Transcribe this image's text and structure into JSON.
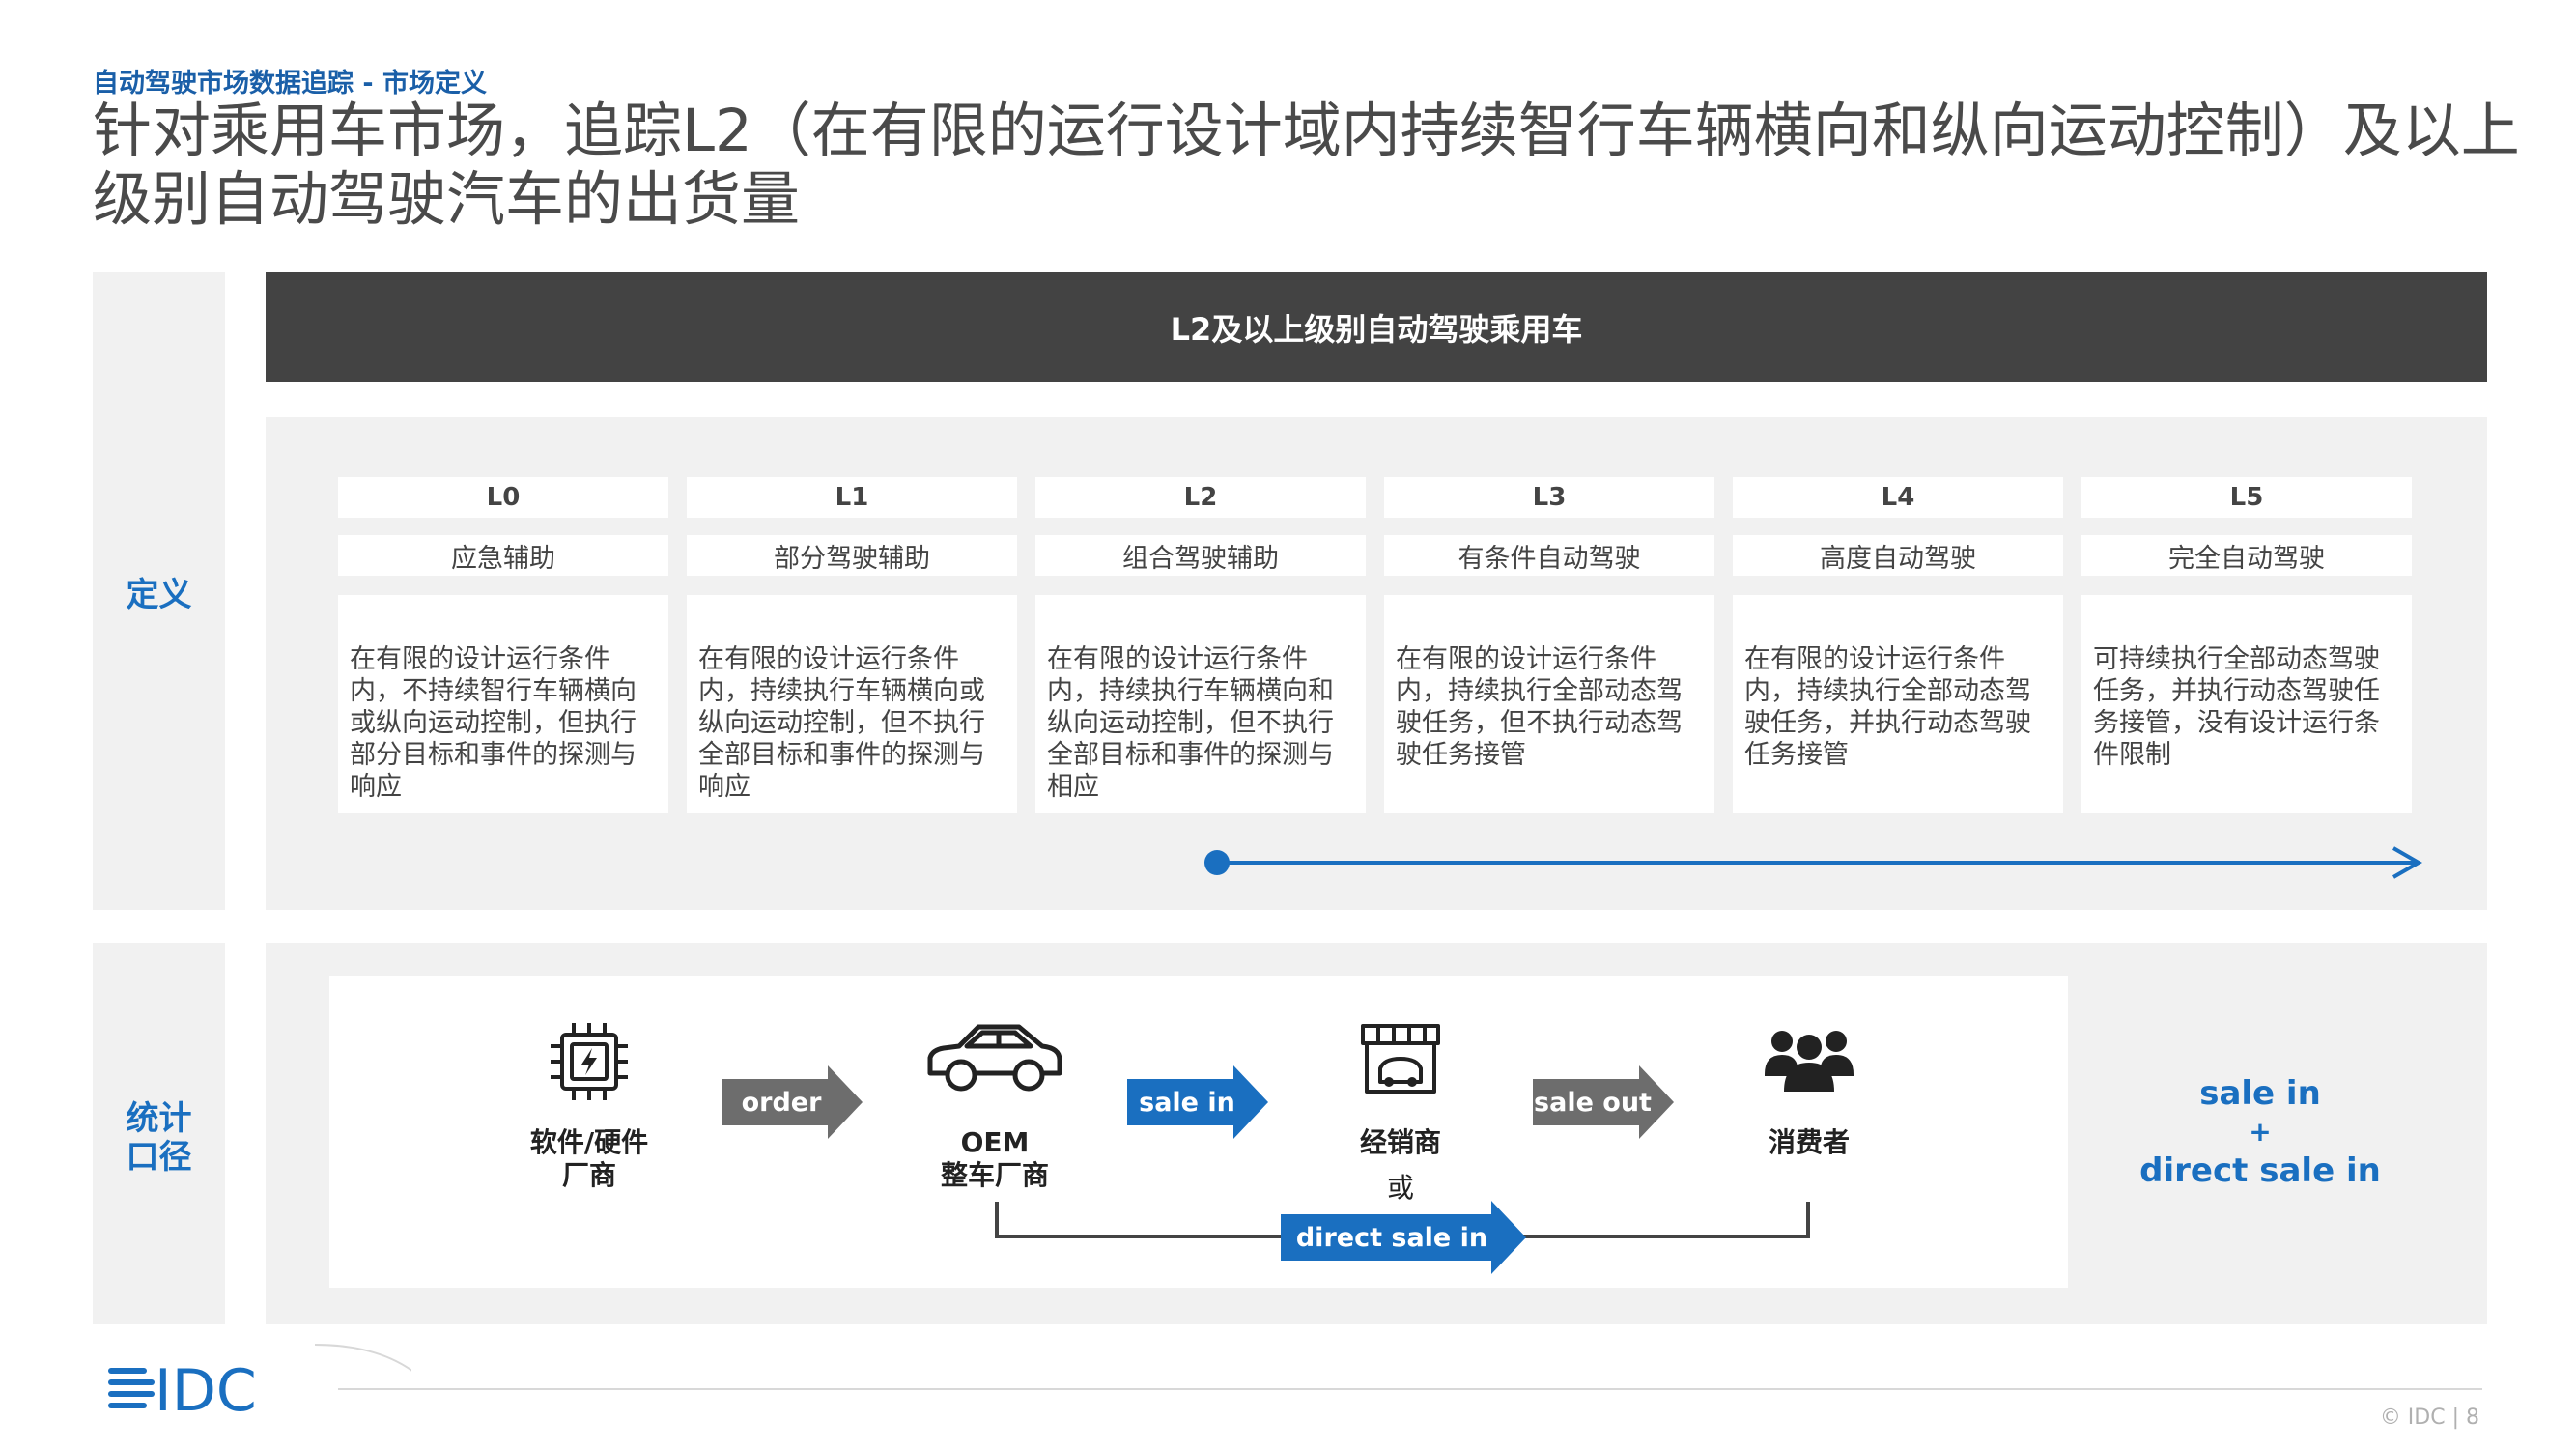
{
  "header": {
    "supertitle": "自动驾驶市场数据追踪 - 市场定义",
    "title": "针对乘用车市场，追踪L2（在有限的运行设计域内持续智行车辆横向和纵向运动控制）及以上级别自动驾驶汽车的出货量"
  },
  "sections": {
    "definition_label": "定义",
    "scope_label_line1": "统计",
    "scope_label_line2": "口径"
  },
  "banner": {
    "text": "L2及以上级别自动驾驶乘用车"
  },
  "levels": [
    {
      "level": "L0",
      "name": "应急辅助",
      "desc": "在有限的设计运行条件内，不持续智行车辆横向或纵向运动控制，但执行部分目标和事件的探测与响应"
    },
    {
      "level": "L1",
      "name": "部分驾驶辅助",
      "desc": "在有限的设计运行条件内，持续执行车辆横向或纵向运动控制，但不执行全部目标和事件的探测与响应"
    },
    {
      "level": "L2",
      "name": "组合驾驶辅助",
      "desc": "在有限的设计运行条件内，持续执行车辆横向和纵向运动控制，但不执行全部目标和事件的探测与相应"
    },
    {
      "level": "L3",
      "name": "有条件自动驾驶",
      "desc": "在有限的设计运行条件内，持续执行全部动态驾驶任务，但不执行动态驾驶任务接管"
    },
    {
      "level": "L4",
      "name": "高度自动驾驶",
      "desc": "在有限的设计运行条件内，持续执行全部动态驾驶任务，并执行动态驾驶任务接管"
    },
    {
      "level": "L5",
      "name": "完全自动驾驶",
      "desc": "可持续执行全部动态驾驶任务，并执行动态驾驶任务接管，没有设计运行条件限制"
    }
  ],
  "flow": {
    "supplier_line1": "软件/硬件",
    "supplier_line2": "厂商",
    "oem_line1": "OEM",
    "oem_line2": "整车厂商",
    "dealer": "经销商",
    "or": "或",
    "consumer": "消费者",
    "arrow_order": "order",
    "arrow_sale_in": "sale in",
    "arrow_sale_out": "sale out",
    "arrow_direct": "direct sale in",
    "icons": [
      "chip-icon",
      "car-icon",
      "store-icon",
      "people-icon"
    ],
    "colors": {
      "gray_arrow": "#6d6d6d",
      "blue_arrow": "#1a6fc0"
    }
  },
  "summary": {
    "line1": "sale in",
    "plus": "+",
    "line2": "direct sale in"
  },
  "footer": {
    "logo_text": "IDC",
    "copyright": "© IDC |  8"
  }
}
